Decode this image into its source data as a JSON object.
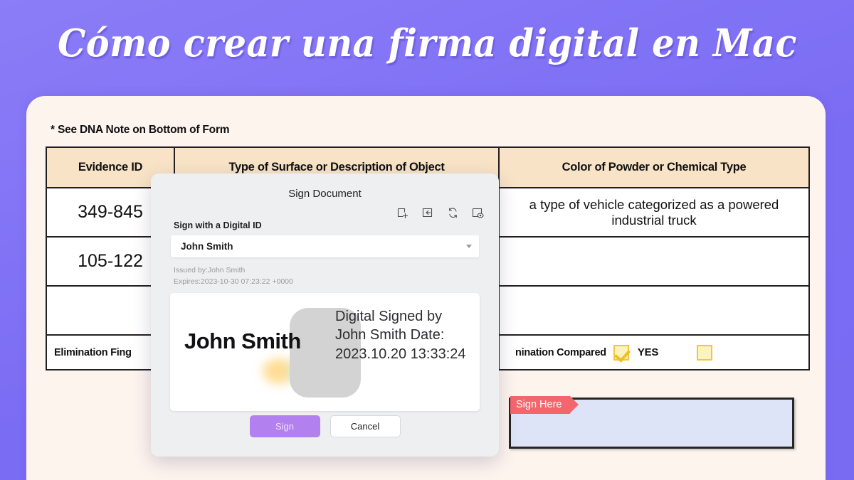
{
  "banner": {
    "title": "Cómo crear una firma digital en Mac",
    "background_color": "#7d70f5",
    "title_color": "#ffffff"
  },
  "document": {
    "card_background": "#fdf4ee",
    "dna_note": "* See DNA Note on Bottom of Form",
    "table": {
      "header_background": "#f8e3c6",
      "headers": [
        "Evidence ID",
        "Type of Surface or Description of Object",
        "Color of Powder or Chemical Type"
      ],
      "rows": [
        {
          "evidence_id": "349-845",
          "surface": "",
          "color": "a type of vehicle categorized as a powered industrial truck"
        },
        {
          "evidence_id": "105-122",
          "surface": "",
          "color": ""
        },
        {
          "evidence_id": "",
          "surface": "",
          "color": ""
        }
      ],
      "footer": {
        "left_label": "Elimination Fing",
        "compared_label": "nination Compared",
        "checkbox_checked_label": "YES",
        "checkbox_color": "#f2c83a"
      }
    },
    "sign_field": {
      "tag_label": "Sign Here",
      "tag_color": "#f4666e",
      "field_color": "#dee4f7"
    }
  },
  "dialog": {
    "title": "Sign Document",
    "toolbar": [
      {
        "name": "add-signature-icon",
        "label": "Add"
      },
      {
        "name": "import-signature-icon",
        "label": "Import"
      },
      {
        "name": "refresh-icon",
        "label": "Refresh"
      },
      {
        "name": "preview-icon",
        "label": "Preview"
      }
    ],
    "digital_id_label": "Sign with a Digital ID",
    "digital_id_value": "John Smith",
    "issued_by": "Issued by:John Smith",
    "expires": "Expires:2023-10-30 07:23:22 +0000",
    "preview": {
      "signature_name": "John Smith",
      "info_text": "Digital Signed by John Smith Date: 2023.10.20 13:33:24"
    },
    "buttons": {
      "sign": "Sign",
      "cancel": "Cancel",
      "sign_color": "#b380ef"
    }
  }
}
